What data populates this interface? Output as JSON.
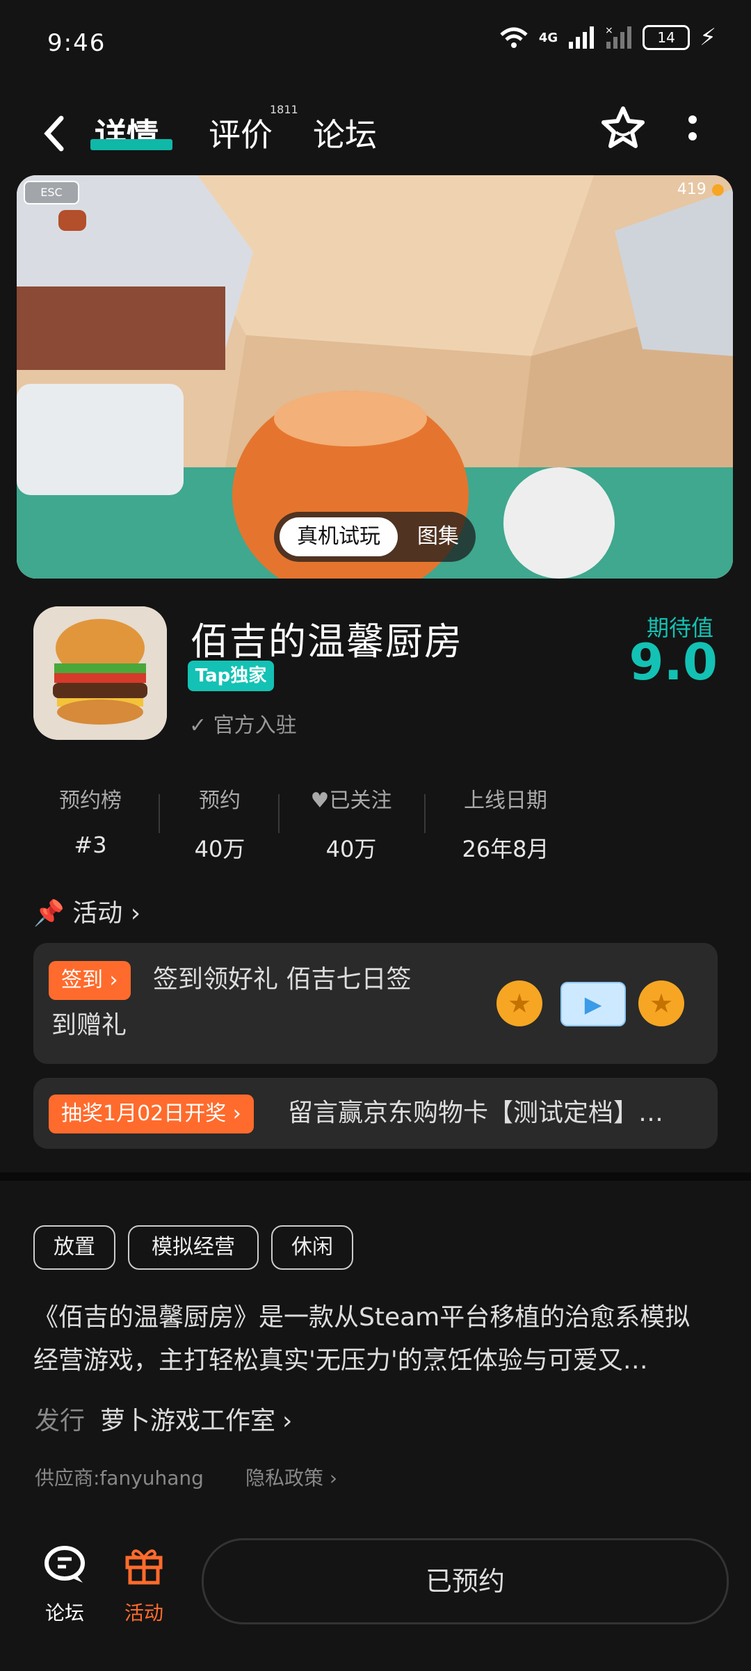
{
  "status_bar": {
    "time": "9:46",
    "network": "4G",
    "battery": "14"
  },
  "nav": {
    "back_icon": "chevron-left-icon",
    "tabs": [
      {
        "label": "详情",
        "active": true
      },
      {
        "label": "评价",
        "count": "1811"
      },
      {
        "label": "论坛"
      }
    ],
    "star_icon": "star-outline-icon",
    "more_icon": "more-vertical-icon"
  },
  "banner": {
    "esc_label": "ESC",
    "coin_count": "419",
    "switch": {
      "on": "真机试玩",
      "off": "图集"
    }
  },
  "game": {
    "title": "佰吉的温馨厨房",
    "badge": "Tap独家",
    "official": "官方入驻",
    "expect_label": "期待值",
    "expect_value": "9.0"
  },
  "stats": [
    {
      "label": "预约榜",
      "value": "#3"
    },
    {
      "label": "预约",
      "value": "40万"
    },
    {
      "label": "已关注",
      "value": "40万"
    },
    {
      "label": "上线日期",
      "value": "26年8月"
    }
  ],
  "activity": {
    "heading": "活动",
    "signin": {
      "tag": "签到",
      "text_line1": "签到领好礼 佰吉七日签",
      "text_line2": "到赠礼"
    },
    "lottery": {
      "tag": "抽奖1月02日开奖",
      "text": "留言赢京东购物卡【测试定档】…"
    }
  },
  "tags": [
    "放置",
    "模拟经营",
    "休闲"
  ],
  "description": {
    "line1": "《佰吉的温馨厨房》是一款从Steam平台移植的治愈系模拟",
    "line2": "经营游戏，主打轻松真实'无压力'的烹饪体验与可爱又…"
  },
  "publisher": {
    "label": "发行",
    "name": "萝卜游戏工作室"
  },
  "supplier": {
    "text": "供应商:fanyuhang",
    "privacy": "隐私政策"
  },
  "bottom": {
    "forum": "论坛",
    "activity": "活动",
    "reserve": "已预约"
  },
  "colors": {
    "accent": "#13c2b4",
    "orange": "#ff6b2c",
    "bg": "#141414"
  }
}
